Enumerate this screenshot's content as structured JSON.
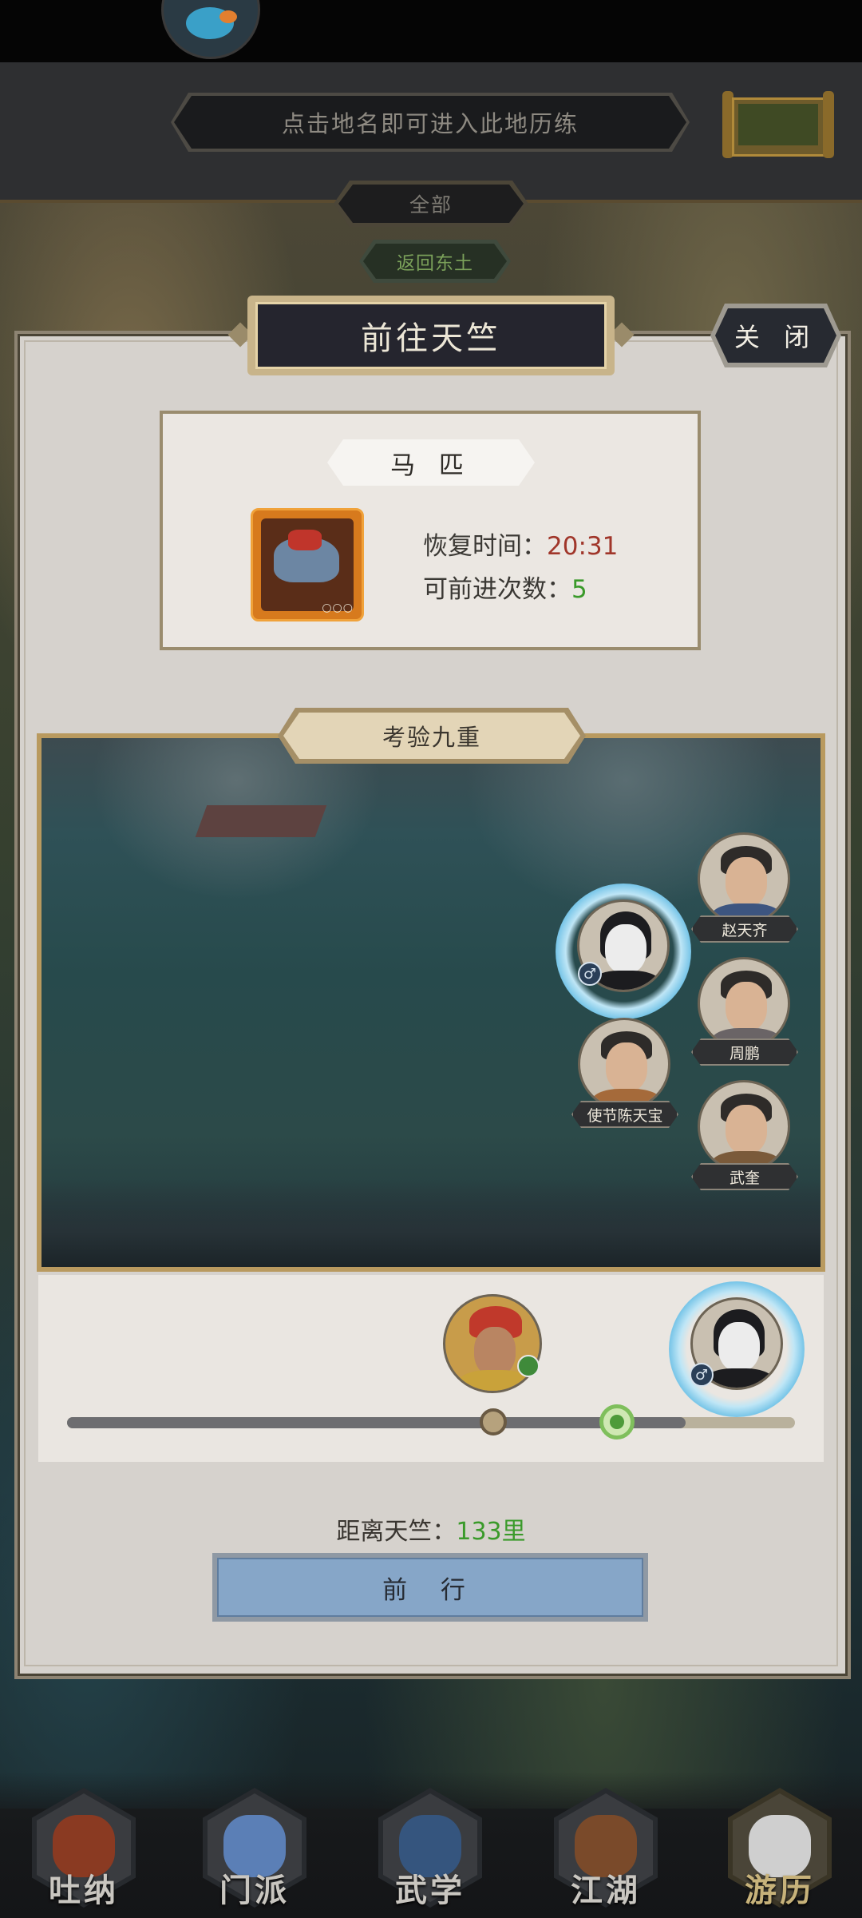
{
  "header": {
    "hint_text": "点击地名即可进入此地历练",
    "filter_all_label": "全部",
    "return_label": "返回东土"
  },
  "dialog": {
    "title": "前往天竺",
    "close_label": "关 闭",
    "horse": {
      "tag": "马 匹",
      "item_dots": "○○○",
      "recover_label": "恢复时间：",
      "recover_value": "20:31",
      "advance_label": "可前进次数：",
      "advance_value": "5"
    },
    "battle": {
      "title": "考验九重",
      "characters": [
        {
          "name": "赵天齐"
        },
        {
          "name": "周鹏"
        },
        {
          "name": "使节陈天宝"
        },
        {
          "name": "武奎"
        }
      ],
      "gender_symbol": "♂"
    },
    "progress": {
      "fill_fraction": 0.85,
      "enemy_position_fraction": 0.585,
      "player_position_fraction": 0.755
    },
    "distance_label": "距离天竺：",
    "distance_value": "133里",
    "go_label": "前 行"
  },
  "colors": {
    "accent_green": "#3a9a2a",
    "accent_red": "#a0362a",
    "go_button": "#86a6c8"
  },
  "bottom_nav": [
    {
      "label": "吐纳",
      "icon": "meditating-monk-icon",
      "active": false
    },
    {
      "label": "门派",
      "icon": "sect-banners-icon",
      "active": false
    },
    {
      "label": "武学",
      "icon": "martial-books-icon",
      "active": false
    },
    {
      "label": "江湖",
      "icon": "bamboo-hat-icon",
      "active": false
    },
    {
      "label": "游历",
      "icon": "horse-icon",
      "active": true
    }
  ]
}
